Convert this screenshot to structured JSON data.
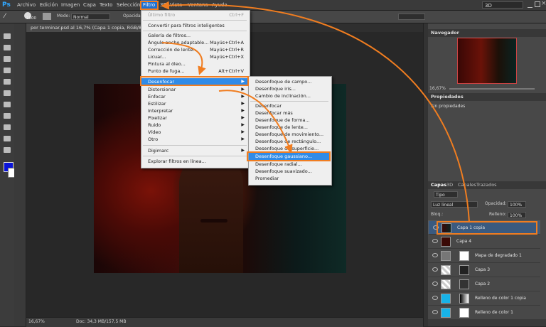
{
  "app": {
    "logo": "Ps",
    "workspace": "3D"
  },
  "menubar": {
    "items": [
      "Archivo",
      "Edición",
      "Imagen",
      "Capa",
      "Texto",
      "Selección",
      "Filtro",
      "3D",
      "Vista",
      "Ventana",
      "Ayuda"
    ],
    "active": "Filtro"
  },
  "options_bar": {
    "brush_size": "1500",
    "mode_label": "Modo:",
    "mode_value": "Normal",
    "opacity_label": "Opacidad"
  },
  "document": {
    "tab_title": "por terminar.psd al 16,7% (Capa 1 copia, RGB/8) *",
    "zoom": "16,67%",
    "doc_info": "Doc: 34,3 MB/157,5 MB"
  },
  "colors": {
    "foreground": "#0a14d8",
    "background": "#ffffff",
    "highlight": "#2f8be8",
    "annotation": "#f07d20"
  },
  "filter_menu": {
    "items": [
      {
        "label": "Último filtro",
        "shortcut": "Ctrl+F",
        "disabled": true
      },
      {
        "label": "Convertir para filtros inteligentes"
      },
      {
        "label": "Galería de filtros..."
      },
      {
        "label": "Ángulo ancho adaptable...",
        "shortcut": "Mayús+Ctrl+A"
      },
      {
        "label": "Corrección de lente...",
        "shortcut": "Mayús+Ctrl+R"
      },
      {
        "label": "Licuar...",
        "shortcut": "Mayús+Ctrl+X"
      },
      {
        "label": "Pintura al óleo..."
      },
      {
        "label": "Punto de fuga...",
        "shortcut": "Alt+Ctrl+V"
      },
      {
        "label": "Desenfocar",
        "submenu": true,
        "highlighted": true
      },
      {
        "label": "Distorsionar",
        "submenu": true
      },
      {
        "label": "Enfocar",
        "submenu": true
      },
      {
        "label": "Estilizar",
        "submenu": true
      },
      {
        "label": "Interpretar",
        "submenu": true
      },
      {
        "label": "Pixelizar",
        "submenu": true
      },
      {
        "label": "Ruido",
        "submenu": true
      },
      {
        "label": "Vídeo",
        "submenu": true
      },
      {
        "label": "Otro",
        "submenu": true
      },
      {
        "label": "Digimarc",
        "submenu": true
      },
      {
        "label": "Explorar filtros en línea..."
      }
    ]
  },
  "blur_submenu": {
    "items": [
      {
        "label": "Desenfoque de campo..."
      },
      {
        "label": "Desenfoque iris..."
      },
      {
        "label": "Cambio de inclinación..."
      },
      {
        "label": "Desenfocar"
      },
      {
        "label": "Desenfocar más"
      },
      {
        "label": "Desenfoque de forma..."
      },
      {
        "label": "Desenfoque de lente..."
      },
      {
        "label": "Desenfoque de movimiento..."
      },
      {
        "label": "Desenfoque de rectángulo..."
      },
      {
        "label": "Desenfoque de superficie..."
      },
      {
        "label": "Desenfoque gaussiano...",
        "highlighted": true
      },
      {
        "label": "Desenfoque radial..."
      },
      {
        "label": "Desenfoque suavizado..."
      },
      {
        "label": "Promediar"
      }
    ]
  },
  "navigator": {
    "title": "Navegador",
    "zoom": "16,67%"
  },
  "properties": {
    "title": "Propiedades",
    "text": "Sin propiedades"
  },
  "layers_panel": {
    "tabs": [
      "Capas",
      "3D",
      "Canales",
      "Trazados"
    ],
    "filter_kind": "Tipo",
    "blend_mode": "Luz lineal",
    "opacity_label": "Opacidad:",
    "opacity_value": "100%",
    "lock_label": "Bloq.:",
    "fill_label": "Relleno:",
    "fill_value": "100%",
    "layers": [
      {
        "name": "Capa 1 copia",
        "selected": true
      },
      {
        "name": "Capa 4"
      },
      {
        "name": "Mapa de degradado 1"
      },
      {
        "name": "Capa 3"
      },
      {
        "name": "Capa 2"
      },
      {
        "name": "Relleno de color 1 copia"
      },
      {
        "name": "Relleno de color 1"
      }
    ]
  }
}
